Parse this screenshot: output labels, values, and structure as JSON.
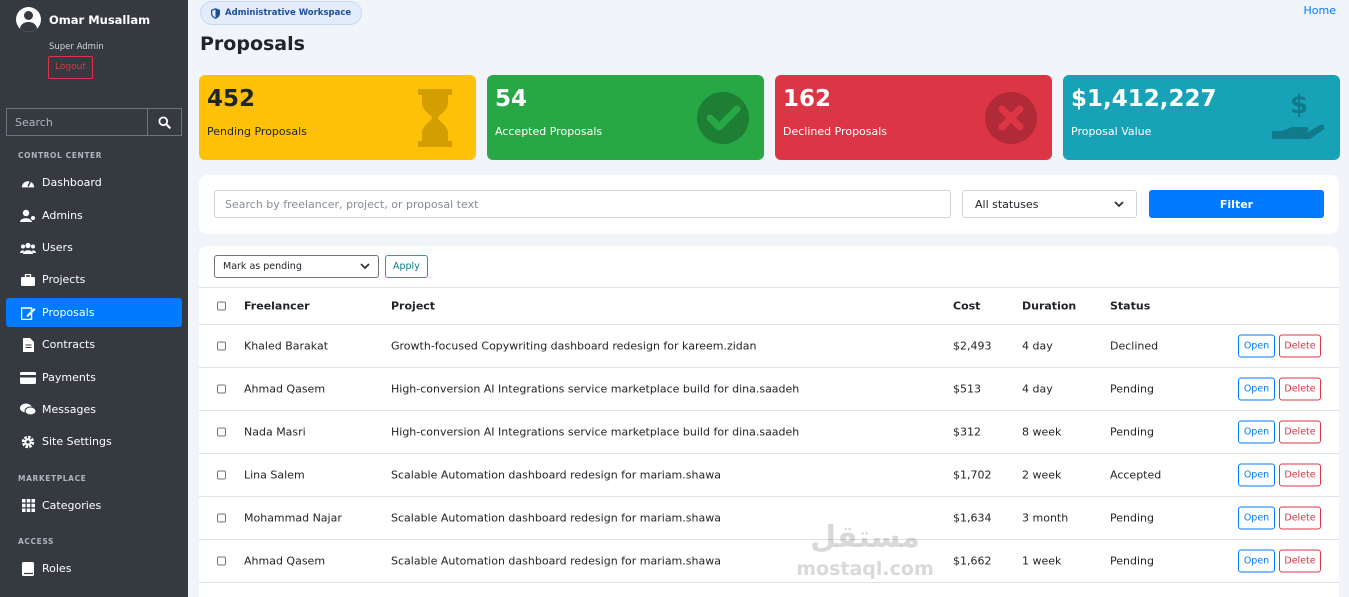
{
  "user": {
    "name": "Omar Musallam",
    "role": "Super Admin",
    "logout_label": "Logout"
  },
  "sidebar": {
    "search_placeholder": "Search",
    "sections": {
      "control": "CONTROL CENTER",
      "marketplace": "MARKETPLACE",
      "access": "ACCESS"
    },
    "items": [
      {
        "label": "Dashboard",
        "icon": "dashboard-icon"
      },
      {
        "label": "Admins",
        "icon": "admin-icon"
      },
      {
        "label": "Users",
        "icon": "users-icon"
      },
      {
        "label": "Projects",
        "icon": "briefcase-icon"
      },
      {
        "label": "Proposals",
        "icon": "edit-icon",
        "active": true
      },
      {
        "label": "Contracts",
        "icon": "file-icon"
      },
      {
        "label": "Payments",
        "icon": "credit-card-icon"
      },
      {
        "label": "Messages",
        "icon": "comments-icon"
      },
      {
        "label": "Site Settings",
        "icon": "gear-icon"
      },
      {
        "label": "Categories",
        "icon": "grid-icon"
      },
      {
        "label": "Roles",
        "icon": "book-icon"
      }
    ]
  },
  "header": {
    "workspace_badge": "Administrative Workspace",
    "home_link": "Home",
    "title": "Proposals"
  },
  "stats": [
    {
      "value": "452",
      "label": "Pending Proposals",
      "color": "#ffc107",
      "icon": "hourglass-icon"
    },
    {
      "value": "54",
      "label": "Accepted Proposals",
      "color": "#28a745",
      "icon": "check-circle-icon"
    },
    {
      "value": "162",
      "label": "Declined Proposals",
      "color": "#dc3545",
      "icon": "x-circle-icon"
    },
    {
      "value": "$1,412,227",
      "label": "Proposal Value",
      "color": "#17a2b8",
      "icon": "hand-dollar-icon"
    }
  ],
  "filters": {
    "search_placeholder": "Search by freelancer, project, or proposal text",
    "status_value": "All statuses",
    "button_label": "Filter"
  },
  "bulk": {
    "action_value": "Mark as pending",
    "apply_label": "Apply"
  },
  "table": {
    "columns": {
      "freelancer": "Freelancer",
      "project": "Project",
      "cost": "Cost",
      "duration": "Duration",
      "status": "Status"
    },
    "open_label": "Open",
    "delete_label": "Delete",
    "rows": [
      {
        "freelancer": "Khaled Barakat",
        "project": "Growth-focused Copywriting dashboard redesign for kareem.zidan",
        "cost": "$2,493",
        "duration": "4 day",
        "status": "Declined"
      },
      {
        "freelancer": "Ahmad Qasem",
        "project": "High-conversion AI Integrations service marketplace build for dina.saadeh",
        "cost": "$513",
        "duration": "4 day",
        "status": "Pending"
      },
      {
        "freelancer": "Nada Masri",
        "project": "High-conversion AI Integrations service marketplace build for dina.saadeh",
        "cost": "$312",
        "duration": "8 week",
        "status": "Pending"
      },
      {
        "freelancer": "Lina Salem",
        "project": "Scalable Automation dashboard redesign for mariam.shawa",
        "cost": "$1,702",
        "duration": "2 week",
        "status": "Accepted"
      },
      {
        "freelancer": "Mohammad Najar",
        "project": "Scalable Automation dashboard redesign for mariam.shawa",
        "cost": "$1,634",
        "duration": "3 month",
        "status": "Pending"
      },
      {
        "freelancer": "Ahmad Qasem",
        "project": "Scalable Automation dashboard redesign for mariam.shawa",
        "cost": "$1,662",
        "duration": "1 week",
        "status": "Pending"
      }
    ]
  },
  "watermark": {
    "arabic": "مستقل",
    "latin": "mostaql.com"
  }
}
